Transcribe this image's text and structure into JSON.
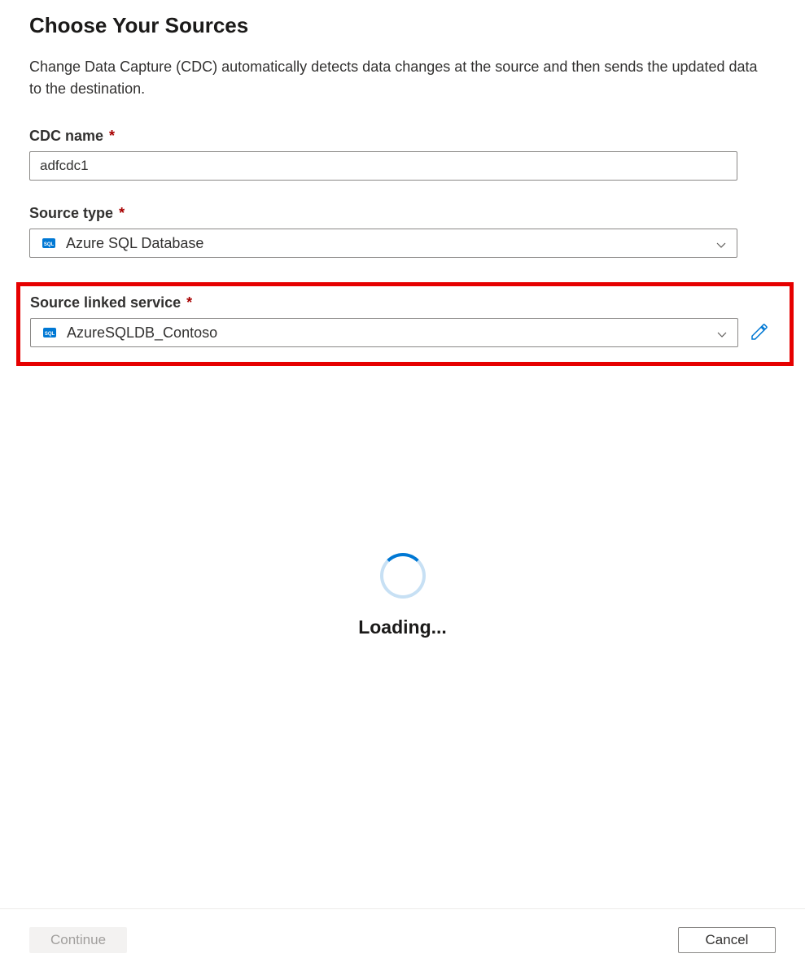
{
  "header": {
    "title": "Choose Your Sources",
    "description": "Change Data Capture (CDC) automatically detects data changes at the source and then sends the updated data to the destination."
  },
  "fields": {
    "cdc_name": {
      "label": "CDC name",
      "value": "adfcdc1",
      "required": true
    },
    "source_type": {
      "label": "Source type",
      "value": "Azure SQL Database",
      "required": true,
      "icon": "sql-icon"
    },
    "source_linked_service": {
      "label": "Source linked service",
      "value": "AzureSQLDB_Contoso",
      "required": true,
      "icon": "sql-icon"
    }
  },
  "loading": {
    "text": "Loading..."
  },
  "footer": {
    "continue_label": "Continue",
    "cancel_label": "Cancel"
  },
  "colors": {
    "highlight_border": "#e60000",
    "required_asterisk": "#a80000",
    "primary": "#0078d4"
  }
}
